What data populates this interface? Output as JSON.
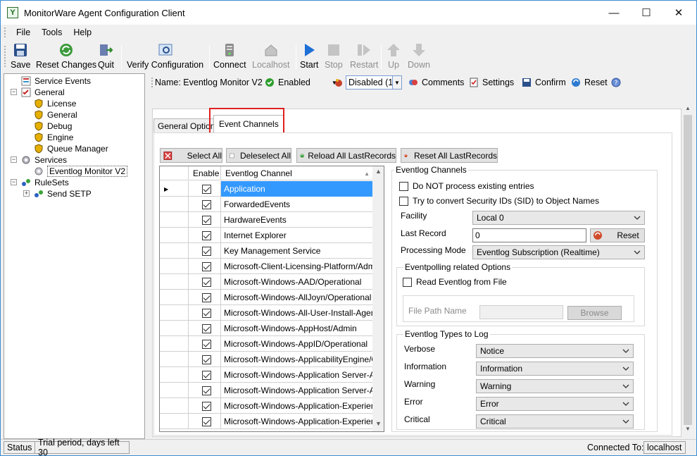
{
  "window": {
    "title": "MonitorWare Agent Configuration Client"
  },
  "menu": [
    "File",
    "Tools",
    "Help"
  ],
  "toolbar": {
    "save": "Save",
    "reset_changes": "Reset Changes",
    "quit": "Quit",
    "verify": "Verify Configuration",
    "connect": "Connect",
    "localhost": "Localhost",
    "start": "Start",
    "stop": "Stop",
    "restart": "Restart",
    "up": "Up",
    "down": "Down"
  },
  "tree": {
    "service_events": "Service Events",
    "general": "General",
    "license": "License",
    "general_child": "General",
    "debug": "Debug",
    "engine": "Engine",
    "queue_manager": "Queue Manager",
    "services": "Services",
    "eventlog_monitor": "Eventlog Monitor V2",
    "rulesets": "RuleSets",
    "send_setp": "Send SETP"
  },
  "header": {
    "name": "Name: Eventlog Monitor V2",
    "enabled": "Enabled",
    "disabled": "Disabled (1",
    "comments": "Comments",
    "settings": "Settings",
    "confirm": "Confirm",
    "reset": "Reset"
  },
  "tabs": {
    "general_options": "General Options",
    "event_channels": "Event Channels"
  },
  "actions": {
    "select_all": "Select All",
    "deselect_all": "Deleselect All",
    "reload_all": "Reload All LastRecords",
    "reset_all": "Reset All LastRecords"
  },
  "grid": {
    "col_enable": "Enable",
    "col_channel": "Eventlog Channel",
    "rows": [
      {
        "channel": "Application",
        "enabled": true
      },
      {
        "channel": "ForwardedEvents",
        "enabled": true
      },
      {
        "channel": "HardwareEvents",
        "enabled": true
      },
      {
        "channel": "Internet Explorer",
        "enabled": true
      },
      {
        "channel": "Key Management Service",
        "enabled": true
      },
      {
        "channel": "Microsoft-Client-Licensing-Platform/Admin",
        "enabled": true
      },
      {
        "channel": "Microsoft-Windows-AAD/Operational",
        "enabled": true
      },
      {
        "channel": "Microsoft-Windows-AllJoyn/Operational",
        "enabled": true
      },
      {
        "channel": "Microsoft-Windows-All-User-Install-Agent/...",
        "enabled": true
      },
      {
        "channel": "Microsoft-Windows-AppHost/Admin",
        "enabled": true
      },
      {
        "channel": "Microsoft-Windows-AppID/Operational",
        "enabled": true
      },
      {
        "channel": "Microsoft-Windows-ApplicabilityEngine/O...",
        "enabled": true
      },
      {
        "channel": "Microsoft-Windows-Application Server-Ap...",
        "enabled": true
      },
      {
        "channel": "Microsoft-Windows-Application Server-Ap...",
        "enabled": true
      },
      {
        "channel": "Microsoft-Windows-Application-Experienc...",
        "enabled": true
      },
      {
        "channel": "Microsoft-Windows-Application-Experienc...",
        "enabled": true
      }
    ]
  },
  "form": {
    "eventlog_channels": "Eventlog Channels",
    "do_not_process": "Do NOT process existing entries",
    "try_convert": "Try to convert Security IDs (SID) to Object Names",
    "facility_label": "Facility",
    "facility_value": "Local 0",
    "last_record_label": "Last Record",
    "last_record_value": "0",
    "reset": "Reset",
    "processing_mode_label": "Processing Mode",
    "processing_mode_value": "Eventlog Subscription (Realtime)",
    "eventpolling": "Eventpolling related Options",
    "read_from_file": "Read Eventlog from File",
    "file_path_label": "File  Path Name",
    "browse": "Browse",
    "types_to_log": "Eventlog Types to Log",
    "verbose_label": "Verbose",
    "verbose_value": "Notice",
    "information_label": "Information",
    "information_value": "Information",
    "warning_label": "Warning",
    "warning_value": "Warning",
    "error_label": "Error",
    "error_value": "Error",
    "critical_label": "Critical",
    "critical_value": "Critical"
  },
  "status": {
    "status_label": "Status",
    "trial": "Trial period, days left 30",
    "connected_to": "Connected To:",
    "host": "localhost"
  }
}
